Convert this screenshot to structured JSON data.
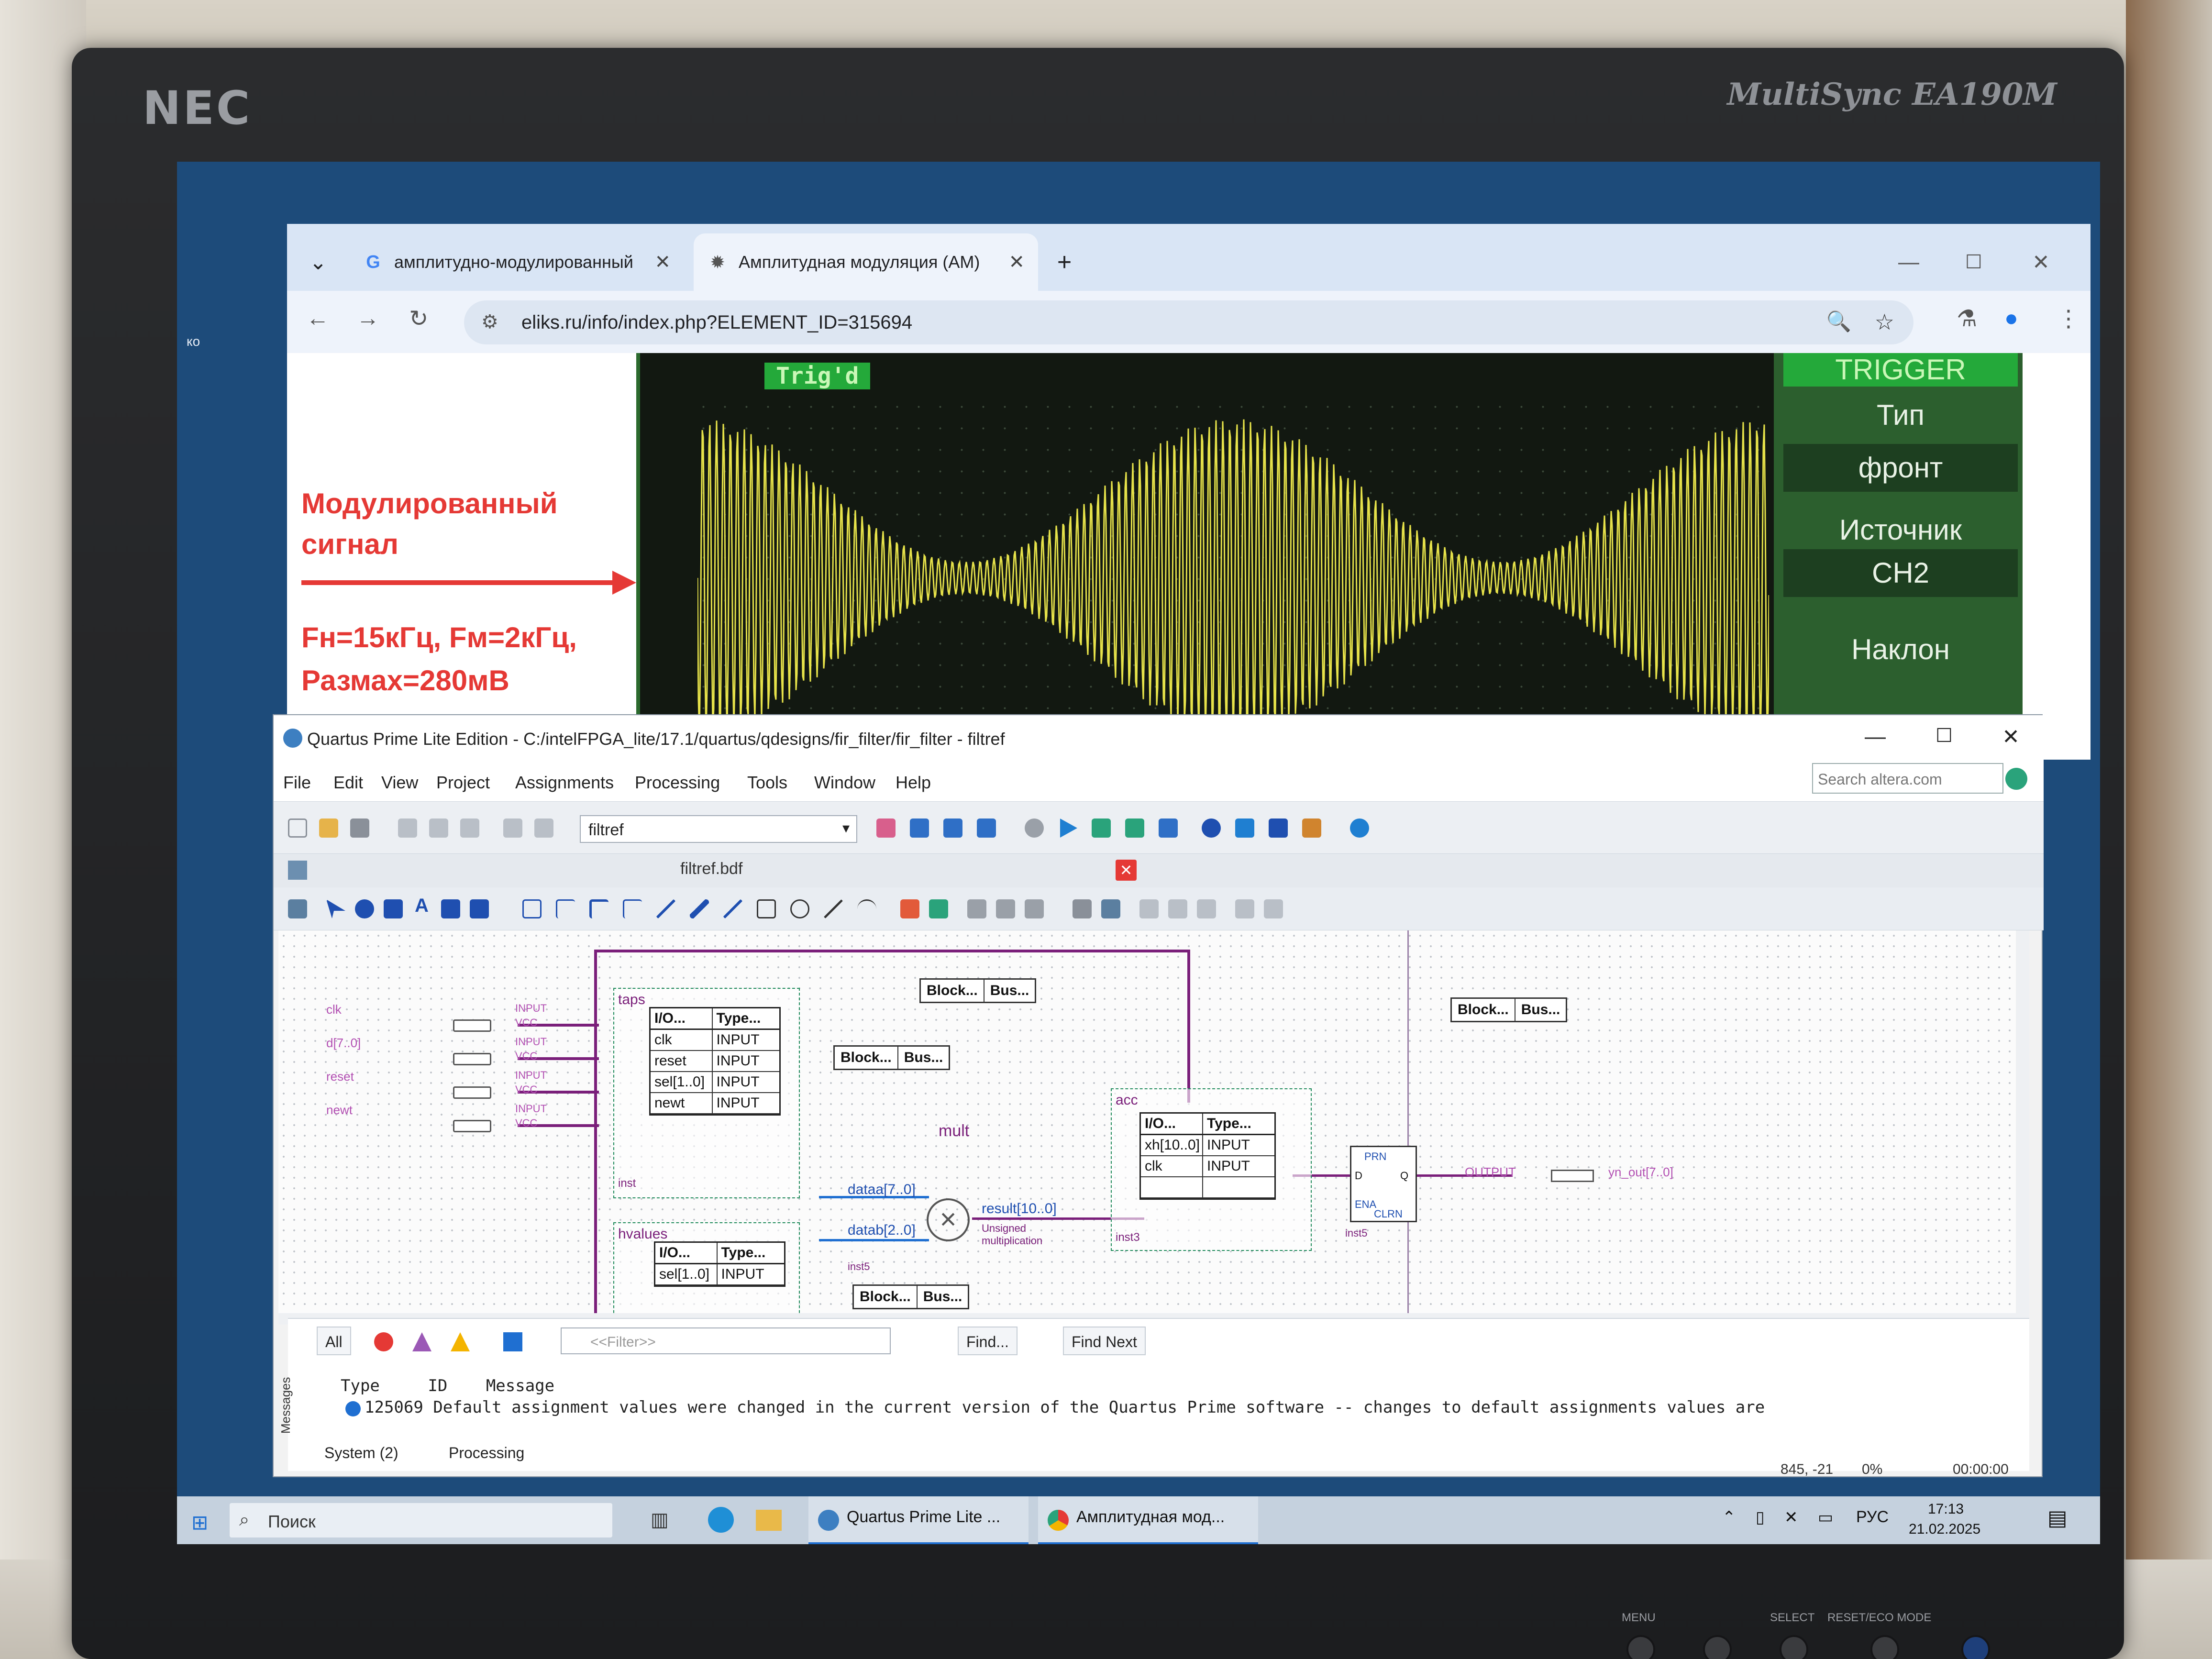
{
  "monitor": {
    "brand": "NEC",
    "model": "MultiSync EA190M",
    "bezel_labels": [
      "MENU",
      "SELECT",
      "RESET/ECO MODE"
    ]
  },
  "browser": {
    "tabs": [
      {
        "label": "амплитудно-модулированный",
        "icon": "google-icon",
        "active": false
      },
      {
        "label": "Амплитудная модуляция (АМ)",
        "icon": "site-icon",
        "active": true
      }
    ],
    "new_tab_symbol": "+",
    "url": "eliks.ru/info/index.php?ELEMENT_ID=315694",
    "page": {
      "caption_lines": [
        "Модулированный",
        "сигнал"
      ],
      "params_lines": [
        "Fн=15кГц, Fм=2кГц,",
        "Размах=280мВ"
      ],
      "scope": {
        "status": "Trig'd",
        "menu_title": "TRIGGER",
        "menu_items": [
          "Тип",
          "фронт",
          "Источник",
          "CH2",
          "Наклон"
        ],
        "accent_color": "#24a93a",
        "trace_color": "#e6e24a"
      }
    }
  },
  "quartus": {
    "title": "Quartus Prime Lite Edition - C:/intelFPGA_lite/17.1/quartus/qdesigns/fir_filter/fir_filter - filtref",
    "menu": [
      "File",
      "Edit",
      "View",
      "Project",
      "Assignments",
      "Processing",
      "Tools",
      "Window",
      "Help"
    ],
    "search_placeholder": "Search altera.com",
    "project_combo": "filtref",
    "document_tab": "filtref.bdf",
    "schematic": {
      "taps": {
        "name": "taps",
        "instance": "inst",
        "headers": [
          "I/O...",
          "Type..."
        ],
        "rows": [
          [
            "clk",
            "INPUT"
          ],
          [
            "reset",
            "INPUT"
          ],
          [
            "sel[1..0]",
            "INPUT"
          ],
          [
            "newt",
            "INPUT"
          ]
        ]
      },
      "hvalues": {
        "name": "hvalues",
        "headers": [
          "I/O...",
          "Type..."
        ],
        "rows": [
          [
            "sel[1..0]",
            "INPUT"
          ]
        ]
      },
      "acc": {
        "name": "acc",
        "instance": "inst3",
        "headers": [
          "I/O...",
          "Type..."
        ],
        "rows": [
          [
            "xh[10..0]",
            "INPUT"
          ],
          [
            "clk",
            "INPUT"
          ]
        ]
      },
      "mult": {
        "name": "mult",
        "port_a": "dataa[7..0]",
        "port_b": "datab[2..0]",
        "result": "result[10..0]",
        "note": "Unsigned multiplication",
        "instance": "inst5"
      },
      "dff": {
        "instance": "inst5",
        "pre": "PRN",
        "clr": "CLRN",
        "d": "D",
        "q": "Q",
        "ena": "ENA"
      },
      "block_chips": [
        [
          "Block...",
          "Bus..."
        ],
        [
          "Block...",
          "Bus..."
        ],
        [
          "Block...",
          "Bus..."
        ],
        [
          "Block...",
          "Bus..."
        ]
      ],
      "input_pins": [
        "clk",
        "d[7..0]",
        "reset",
        "newt"
      ],
      "pin_kind": "INPUT",
      "pin_vcc": "VCC",
      "output_pin": "yn_out[7..0]",
      "output_kind": "OUTPUT"
    },
    "messages": {
      "filter_all": "All",
      "filter_placeholder": "<<Filter>>",
      "find": "Find...",
      "find_next": "Find Next",
      "columns": [
        "Type",
        "ID",
        "Message"
      ],
      "rows": [
        {
          "id": "125069",
          "text": "Default assignment values were changed in the current version of the Quartus Prime software -- changes to default assignments values are"
        }
      ],
      "tabs": [
        "System (2)",
        "Processing"
      ],
      "side_label": "Messages"
    },
    "status": {
      "coords": "845, -21",
      "percent": "0%",
      "time": "00:00:00"
    }
  },
  "taskbar": {
    "search": "Поиск",
    "apps": [
      {
        "label": "Quartus Prime Lite ...",
        "icon": "quartus-icon"
      },
      {
        "label": "Амплитудная мод...",
        "icon": "chrome-icon"
      }
    ],
    "language": "РУС",
    "time": "17:13",
    "date": "21.02.2025"
  }
}
